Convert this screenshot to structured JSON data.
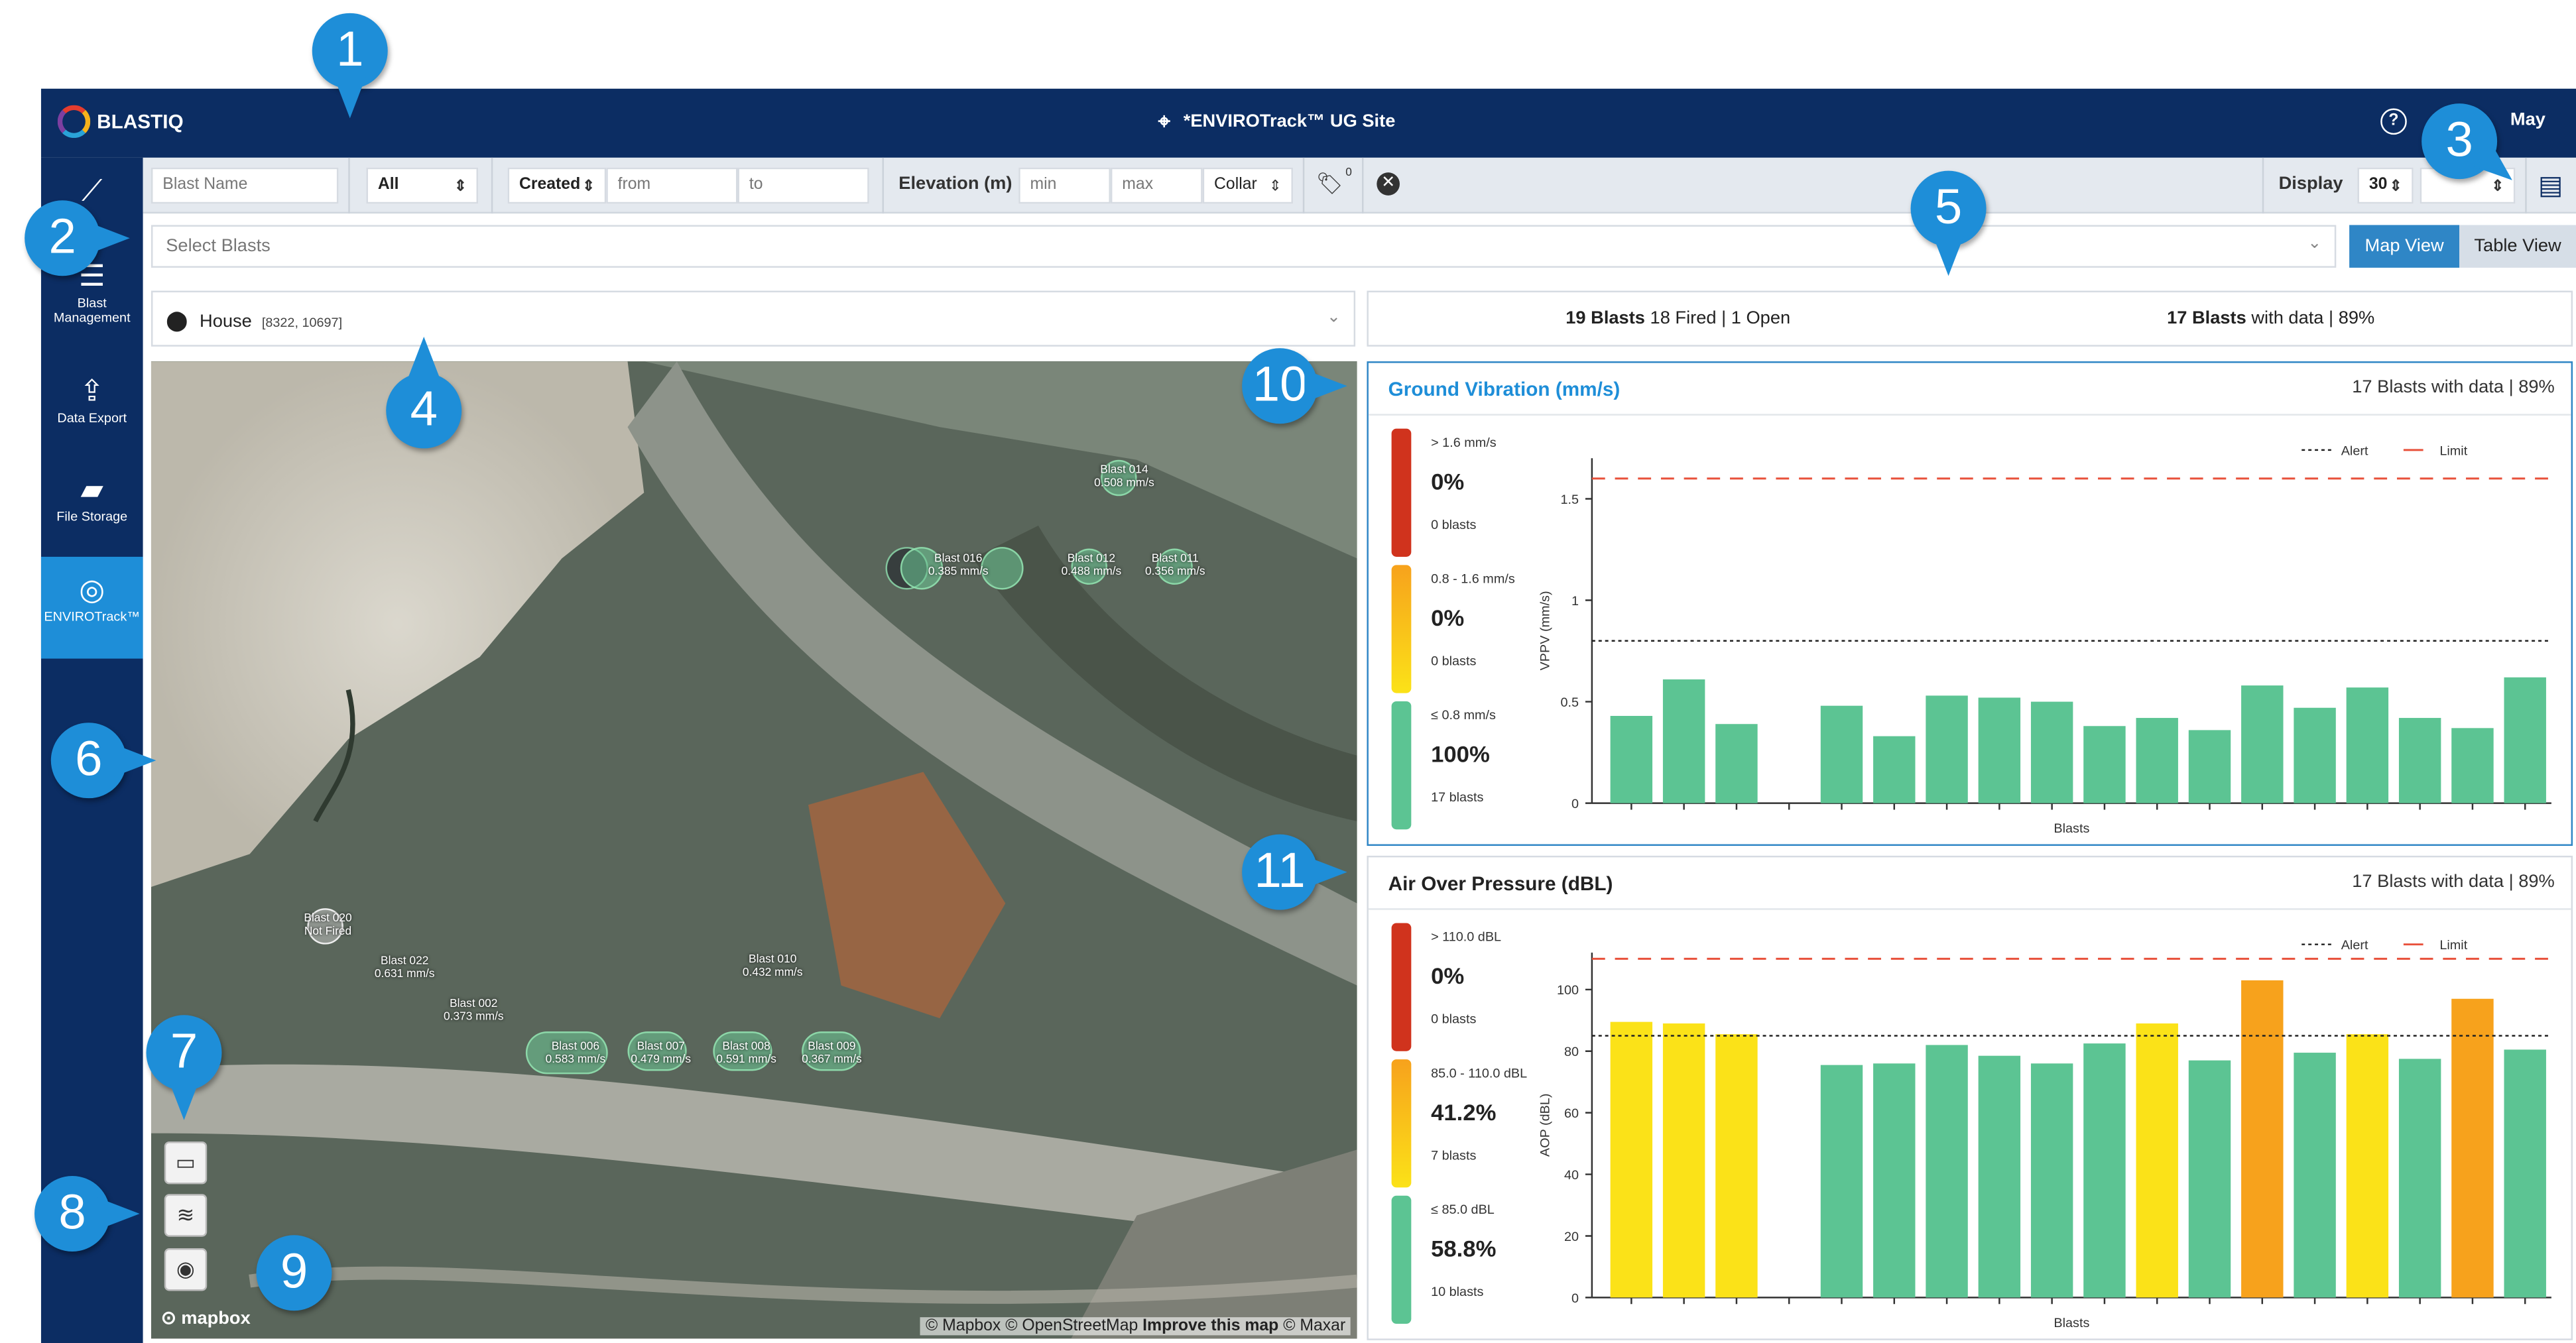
{
  "app": {
    "logo_text": "BLASTIQ",
    "site_title": "*ENVIROTrack™ UG Site",
    "user_name": "May",
    "help_label": "?"
  },
  "sidebar": {
    "items": [
      {
        "label": "",
        "icon": "chart-icon"
      },
      {
        "label": "Blast Management",
        "icon": "blast-list-icon"
      },
      {
        "label": "Data Export",
        "icon": "upload-icon"
      },
      {
        "label": "File Storage",
        "icon": "folder-icon"
      },
      {
        "label": "ENVIROTrack™",
        "icon": "wave-signal-icon"
      }
    ]
  },
  "filters": {
    "blast_name_placeholder": "Blast Name",
    "status_value": "All",
    "date_field_value": "Created",
    "from_placeholder": "from",
    "to_placeholder": "to",
    "elevation_label": "Elevation (m)",
    "min_placeholder": "min",
    "max_placeholder": "max",
    "elevation_ref_value": "Collar",
    "tag_count": "0",
    "display_label": "Display",
    "display_value": "30"
  },
  "select_blasts": {
    "placeholder": "Select Blasts"
  },
  "view_toggle": {
    "map_label": "Map View",
    "table_label": "Table View",
    "active": "map"
  },
  "location": {
    "name": "House",
    "coords": "[8322, 10697]"
  },
  "summary": {
    "blasts_bold": "19 Blasts",
    "blasts_rest": "18 Fired | 1 Open",
    "with_data_bold": "17 Blasts",
    "with_data_rest": "with data | 89%"
  },
  "map": {
    "credit_prefix": "© Mapbox © OpenStreetMap ",
    "credit_link": "Improve this map",
    "credit_suffix": " © Maxar",
    "logo": "mapbox",
    "blasts": [
      {
        "name": "Blast 014",
        "value": "0.508 mm/s"
      },
      {
        "name": "Blast 016",
        "value": "0.385 mm/s"
      },
      {
        "name": "Blast 012",
        "value": "0.488 mm/s"
      },
      {
        "name": "Blast 011",
        "value": "0.356 mm/s"
      },
      {
        "name": "Blast 020",
        "value": "Not Fired"
      },
      {
        "name": "Blast 022",
        "value": "0.631 mm/s"
      },
      {
        "name": "Blast 002",
        "value": "0.373 mm/s"
      },
      {
        "name": "Blast 010",
        "value": "0.432 mm/s"
      },
      {
        "name": "Blast 006",
        "value": "0.583 mm/s"
      },
      {
        "name": "Blast 007",
        "value": "0.479 mm/s"
      },
      {
        "name": "Blast 008",
        "value": "0.591 mm/s"
      },
      {
        "name": "Blast 009",
        "value": "0.367 mm/s"
      }
    ]
  },
  "ground_vibration": {
    "title": "Ground Vibration (mm/s)",
    "count": "17 Blasts with data | 89%",
    "legend": [
      {
        "range": "> 1.6 mm/s",
        "pct": "0%",
        "count": "0 blasts",
        "color": "#d0331d"
      },
      {
        "range": "0.8 - 1.6 mm/s",
        "pct": "0%",
        "count": "0 blasts",
        "color": "#f7a21c"
      },
      {
        "range": "≤ 0.8 mm/s",
        "pct": "100%",
        "count": "17 blasts",
        "color": "#5cc493"
      }
    ],
    "alert_label": "Alert",
    "limit_label": "Limit"
  },
  "air_overpressure": {
    "title": "Air Over Pressure (dBL)",
    "count": "17 Blasts with data | 89%",
    "legend": [
      {
        "range": "> 110.0 dBL",
        "pct": "0%",
        "count": "0 blasts",
        "color": "#d0331d"
      },
      {
        "range": "85.0 - 110.0 dBL",
        "pct": "41.2%",
        "count": "7 blasts",
        "color": "#f7a21c"
      },
      {
        "range": "≤ 85.0 dBL",
        "pct": "58.8%",
        "count": "10 blasts",
        "color": "#5cc493"
      }
    ],
    "alert_label": "Alert",
    "limit_label": "Limit"
  },
  "chart_data": [
    {
      "type": "bar",
      "title": "Ground Vibration (mm/s)",
      "xlabel": "Blasts",
      "ylabel": "VPPV (mm/s)",
      "ylim": [
        0,
        1.7
      ],
      "yticks": [
        "0",
        "0.5",
        "1",
        "1.5"
      ],
      "alert": 0.8,
      "limit": 1.6,
      "values": [
        0.43,
        0.61,
        0.39,
        null,
        0.48,
        0.33,
        0.53,
        0.52,
        0.5,
        0.38,
        0.42,
        0.36,
        0.58,
        0.47,
        0.57,
        0.42,
        0.37,
        0.62
      ],
      "colors": [
        "#5cc493",
        "#5cc493",
        "#5cc493",
        "#5cc493",
        "#5cc493",
        "#5cc493",
        "#5cc493",
        "#5cc493",
        "#5cc493",
        "#5cc493",
        "#5cc493",
        "#5cc493",
        "#5cc493",
        "#5cc493",
        "#5cc493",
        "#5cc493",
        "#5cc493",
        "#5cc493"
      ],
      "grid": false,
      "legend_position": "top-right"
    },
    {
      "type": "bar",
      "title": "Air Over Pressure (dBL)",
      "xlabel": "Blasts",
      "ylabel": "AOP (dBL)",
      "ylim": [
        0,
        112
      ],
      "yticks": [
        "0",
        "20",
        "40",
        "60",
        "80",
        "100"
      ],
      "alert": 85,
      "limit": 110,
      "values": [
        89.5,
        89,
        85.5,
        null,
        75.5,
        76,
        82,
        78.5,
        76,
        82.5,
        89,
        77,
        103,
        79.5,
        85.5,
        77.5,
        97,
        80.5
      ],
      "colors": [
        "#fbe218",
        "#fbe218",
        "#fbe218",
        "#5cc493",
        "#5cc493",
        "#5cc493",
        "#5cc493",
        "#5cc493",
        "#5cc493",
        "#5cc493",
        "#fbe218",
        "#5cc493",
        "#f7a21c",
        "#5cc493",
        "#fbe218",
        "#5cc493",
        "#f7a21c",
        "#5cc493"
      ],
      "grid": false,
      "legend_position": "top-right"
    }
  ],
  "callouts": [
    "1",
    "2",
    "3",
    "4",
    "5",
    "6",
    "7",
    "8",
    "9",
    "10",
    "11"
  ]
}
